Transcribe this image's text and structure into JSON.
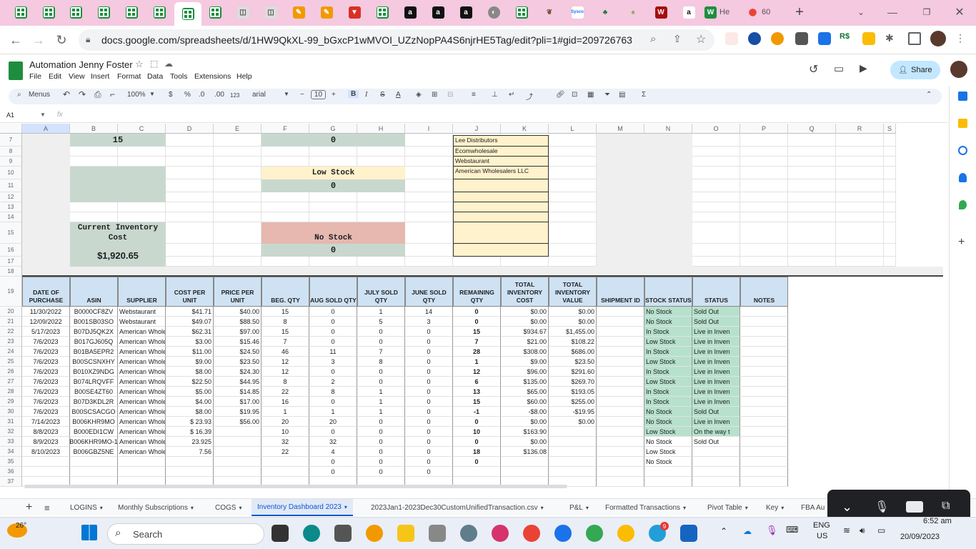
{
  "browser": {
    "url": "docs.google.com/spreadsheets/d/1HW9QkXL-99_bGxcP1wMVOI_UZzNopPA4S6njrHE5Tag/edit?pli=1#gid=209726763",
    "tab_partial_1": "He",
    "tab_partial_2": "60"
  },
  "app": {
    "title": "Automation Jenny Foster",
    "menus": [
      "File",
      "Edit",
      "View",
      "Insert",
      "Format",
      "Data",
      "Tools",
      "Extensions",
      "Help"
    ],
    "share_label": "Share"
  },
  "toolbar": {
    "search": "Menus",
    "zoom": "100%",
    "currency": "$",
    "percent": "%",
    "dec_less": ".0",
    "dec_more": ".00",
    "number_fmt": "123",
    "font": "arial",
    "font_size": "10",
    "bold": "B",
    "italic": "I"
  },
  "formula": {
    "cell_ref": "A1",
    "fx": "fx"
  },
  "columns": [
    "A",
    "B",
    "C",
    "D",
    "E",
    "F",
    "G",
    "H",
    "I",
    "J",
    "K",
    "L",
    "M",
    "N",
    "O",
    "P",
    "Q",
    "R",
    "S"
  ],
  "row_numbers": [
    "7",
    "8",
    "9",
    "10",
    "11",
    "12",
    "13",
    "14",
    "15",
    "16",
    "17",
    "18",
    "19",
    "20",
    "21",
    "22",
    "23",
    "24",
    "25",
    "26",
    "27",
    "28",
    "29",
    "30",
    "31",
    "32",
    "33",
    "34",
    "35",
    "36",
    "37"
  ],
  "summary": {
    "top_count": "15",
    "out_of_stock_count": "0",
    "low_stock_label": "Low Stock",
    "low_stock_count": "0",
    "current_inventory_label": "Current Inventory Cost",
    "current_inventory_value": "$1,920.65",
    "no_stock_label": "No Stock",
    "no_stock_count": "0"
  },
  "suppliers": [
    "Lee Distributors",
    "Ecomwholesale",
    "Webstaurant",
    "American Wholesalers LLC"
  ],
  "table": {
    "headers": [
      "DATE OF PURCHASE",
      "ASIN",
      "SUPPLIER",
      "COST PER UNIT",
      "PRICE PER UNIT",
      "BEG. QTY",
      "AUG SOLD QTY",
      "JULY SOLD QTY",
      "JUNE SOLD QTY",
      "REMAINING QTY",
      "TOTAL INVENTORY COST",
      "TOTAL INVENTORY VALUE",
      "SHIPMENT ID",
      "STOCK STATUS",
      "STATUS",
      "NOTES"
    ],
    "rows": [
      [
        "11/30/2022",
        "B0000CF8ZV",
        "Webstaurant",
        "$41.71",
        "$40.00",
        "15",
        "0",
        "1",
        "14",
        "0",
        "$0.00",
        "$0.00",
        "",
        "No Stock",
        "Sold Out",
        ""
      ],
      [
        "12/09/2022",
        "B001SB03SO",
        "Webstaurant",
        "$49.07",
        "$88.50",
        "8",
        "0",
        "5",
        "3",
        "0",
        "$0.00",
        "$0.00",
        "",
        "No Stock",
        "Sold Out",
        ""
      ],
      [
        "5/17/2023",
        "B07DJ5QK2X",
        "American Whole",
        "$62.31",
        "$97.00",
        "15",
        "0",
        "0",
        "0",
        "15",
        "$934.67",
        "$1,455.00",
        "",
        "In Stock",
        "Live in Inven",
        ""
      ],
      [
        "7/6/2023",
        "B017GJ605Q",
        "American Whole",
        "$3.00",
        "$15.46",
        "7",
        "0",
        "0",
        "0",
        "7",
        "$21.00",
        "$108.22",
        "",
        "Low Stock",
        "Live in Inven",
        ""
      ],
      [
        "7/6/2023",
        "B01BA5EPR2",
        "American Whole",
        "$11.00",
        "$24.50",
        "46",
        "11",
        "7",
        "0",
        "28",
        "$308.00",
        "$686.00",
        "",
        "In Stock",
        "Live in Inven",
        ""
      ],
      [
        "7/6/2023",
        "B00SCSNXHY",
        "American Whole",
        "$9.00",
        "$23.50",
        "12",
        "3",
        "8",
        "0",
        "1",
        "$9.00",
        "$23.50",
        "",
        "Low Stock",
        "Live in Inven",
        ""
      ],
      [
        "7/6/2023",
        "B010XZ9NDG",
        "American Whole",
        "$8.00",
        "$24.30",
        "12",
        "0",
        "0",
        "0",
        "12",
        "$96.00",
        "$291.60",
        "",
        "In Stock",
        "Live in Inven",
        ""
      ],
      [
        "7/6/2023",
        "B074LRQVFF",
        "American Whole",
        "$22.50",
        "$44.95",
        "8",
        "2",
        "0",
        "0",
        "6",
        "$135.00",
        "$269.70",
        "",
        "Low Stock",
        "Live in Inven",
        ""
      ],
      [
        "7/6/2023",
        "B00SE4ZT60",
        "American Whole",
        "$5.00",
        "$14.85",
        "22",
        "8",
        "1",
        "0",
        "13",
        "$65.00",
        "$193.05",
        "",
        "In Stock",
        "Live in Inven",
        ""
      ],
      [
        "7/6/2023",
        "B07D3KDL2R",
        "American Whole",
        "$4.00",
        "$17.00",
        "16",
        "0",
        "1",
        "0",
        "15",
        "$60.00",
        "$255.00",
        "",
        "In Stock",
        "Live in Inven",
        ""
      ],
      [
        "7/6/2023",
        "B00SCSACGO",
        "American Whole",
        "$8.00",
        "$19.95",
        "1",
        "1",
        "1",
        "0",
        "-1",
        "-$8.00",
        "-$19.95",
        "",
        "No Stock",
        "Sold Out",
        ""
      ],
      [
        "7/14/2023",
        "B006KHR9MO",
        "American Whole",
        "$ 23.93",
        "$56.00",
        "20",
        "20",
        "0",
        "0",
        "0",
        "$0.00",
        "$0.00",
        "",
        "No Stock",
        "Live in Inven",
        ""
      ],
      [
        "8/8/2023",
        "B000EDI1CW",
        "American Whole",
        "$ 16.39",
        "",
        "10",
        "0",
        "0",
        "0",
        "10",
        "$163.90",
        "",
        "",
        "Low Stock",
        "On the way t",
        ""
      ],
      [
        "8/9/2023",
        "B006KHR9MO-1",
        "American Whole",
        "23.925",
        "",
        "32",
        "32",
        "0",
        "0",
        "0",
        "$0.00",
        "",
        "",
        "No Stock",
        "Sold Out",
        ""
      ],
      [
        "8/10/2023",
        "B006GBZ5NE",
        "American Whole",
        "7.56",
        "",
        "22",
        "4",
        "0",
        "0",
        "18",
        "$136.08",
        "",
        "",
        "Low Stock",
        "",
        ""
      ],
      [
        "",
        "",
        "",
        "",
        "",
        "",
        "0",
        "0",
        "0",
        "0",
        "",
        "",
        "",
        "No Stock",
        "",
        ""
      ],
      [
        "",
        "",
        "",
        "",
        "",
        "",
        "0",
        "0",
        "0",
        "",
        "",
        "",
        "",
        "",
        "",
        ""
      ],
      [
        "",
        "",
        "",
        "",
        "",
        "",
        "",
        "",
        "",
        "",
        "",
        "",
        "",
        "",
        "",
        ""
      ]
    ]
  },
  "sheet_tabs": [
    "LOGINS",
    "Monthly Subscriptions",
    "COGS",
    "Inventory Dashboard 2023",
    "2023Jan1-2023Dec30CustomUnifiedTransaction.csv",
    "P&L",
    "Formatted Transactions",
    "Pivot Table",
    "Key",
    "FBA Au"
  ],
  "active_sheet": "Inventory Dashboard 2023",
  "taskbar": {
    "weather": "26°",
    "search": "Search",
    "lang_1": "ENG",
    "lang_2": "US",
    "time": "6:52 am",
    "date": "20/09/2023",
    "badge": "9"
  },
  "colors": {
    "header_blue": "#cfe2f3",
    "green_block": "#b7cbbf",
    "low_stock_bg": "#fff2cc",
    "no_stock_bg": "#e6b8af",
    "stock_status_bg": "#b7e1cd",
    "sheets_green": "#1e8e3e",
    "browser_tab_bg": "#f5c9e0"
  }
}
